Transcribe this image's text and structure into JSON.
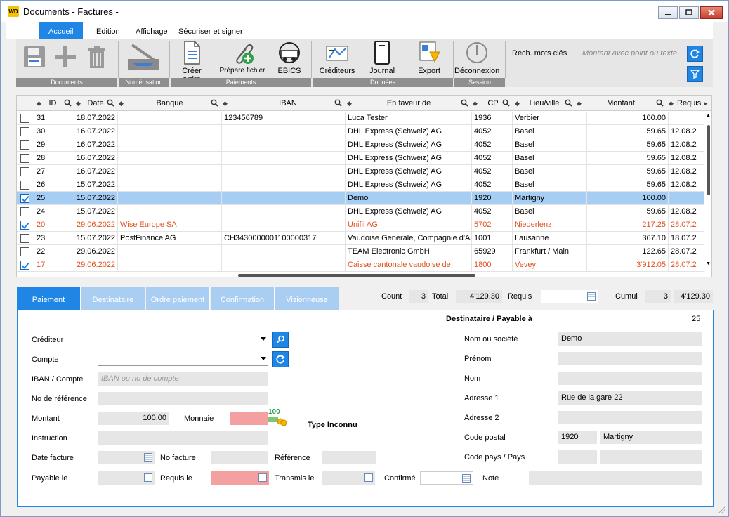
{
  "window": {
    "logo": "WD",
    "title": "Documents - Factures -"
  },
  "menu": {
    "items": [
      "Accueil",
      "Edition",
      "Affichage",
      "Sécuriser et signer"
    ]
  },
  "ribbon": {
    "buttons": [
      "Créer ordre",
      "Prépare fichier",
      "EBICS",
      "Créditeurs",
      "Journal",
      "Export",
      "Déconnexion"
    ],
    "groups": [
      "Documents",
      "Numérisation",
      "Paiements",
      "Données",
      "Session"
    ],
    "search_label": "Rech.  mots clés",
    "search_placeholder": "Montant avec point ou texte"
  },
  "grid": {
    "headers": [
      "ID",
      "Date",
      "Banque",
      "IBAN",
      "En faveur de",
      "CP",
      "Lieu/ville",
      "Montant",
      "Requis"
    ],
    "rows": [
      {
        "checked": false,
        "id": "31",
        "date": "18.07.2022",
        "banque": "",
        "iban": "123456789",
        "faveur": "Luca Tester",
        "cp": "1936",
        "lieu": "Verbier",
        "montant": "100.00",
        "requis": ""
      },
      {
        "checked": false,
        "id": "30",
        "date": "16.07.2022",
        "banque": "",
        "iban": "",
        "faveur": "DHL Express (Schweiz) AG",
        "cp": "4052",
        "lieu": "Basel",
        "montant": "59.65",
        "requis": "12.08.2"
      },
      {
        "checked": false,
        "id": "29",
        "date": "16.07.2022",
        "banque": "",
        "iban": "",
        "faveur": "DHL Express (Schweiz) AG",
        "cp": "4052",
        "lieu": "Basel",
        "montant": "59.65",
        "requis": "12.08.2"
      },
      {
        "checked": false,
        "id": "28",
        "date": "16.07.2022",
        "banque": "",
        "iban": "",
        "faveur": "DHL Express (Schweiz) AG",
        "cp": "4052",
        "lieu": "Basel",
        "montant": "59.65",
        "requis": "12.08.2"
      },
      {
        "checked": false,
        "id": "27",
        "date": "16.07.2022",
        "banque": "",
        "iban": "",
        "faveur": "DHL Express (Schweiz) AG",
        "cp": "4052",
        "lieu": "Basel",
        "montant": "59.65",
        "requis": "12.08.2"
      },
      {
        "checked": false,
        "id": "26",
        "date": "15.07.2022",
        "banque": "",
        "iban": "",
        "faveur": "DHL Express (Schweiz) AG",
        "cp": "4052",
        "lieu": "Basel",
        "montant": "59.65",
        "requis": "12.08.2"
      },
      {
        "checked": true,
        "selected": true,
        "id": "25",
        "date": "15.07.2022",
        "banque": "",
        "iban": "",
        "faveur": "Demo",
        "cp": "1920",
        "lieu": "Martigny",
        "montant": "100.00",
        "requis": ""
      },
      {
        "checked": false,
        "id": "24",
        "date": "15.07.2022",
        "banque": "",
        "iban": "",
        "faveur": "DHL Express (Schweiz) AG",
        "cp": "4052",
        "lieu": "Basel",
        "montant": "59.65",
        "requis": "12.08.2"
      },
      {
        "checked": true,
        "red": true,
        "id": "20",
        "date": "29.06.2022",
        "banque": "Wise Europe SA",
        "iban": "",
        "faveur": "Unifil AG",
        "cp": "5702",
        "lieu": "Niederlenz",
        "montant": "217.25",
        "requis": "28.07.2"
      },
      {
        "checked": false,
        "id": "23",
        "date": "15.07.2022",
        "banque": "PostFinance AG",
        "iban": "CH3430000001100000317",
        "faveur": "Vaudoise Generale, Compagnie d'As",
        "cp": "1001",
        "lieu": " Lausanne",
        "montant": "367.10",
        "requis": "18.07.2"
      },
      {
        "checked": false,
        "id": "22",
        "date": "29.06.2022",
        "banque": "",
        "iban": "",
        "faveur": "TEAM Electronic GmbH",
        "cp": "65929",
        "lieu": "Frankfurt / Main",
        "montant": "122.65",
        "requis": "28.07.2"
      },
      {
        "checked": true,
        "red": true,
        "id": "17",
        "date": "29.06.2022",
        "banque": "",
        "iban": "",
        "faveur": "Caisse cantonale vaudoise de",
        "cp": "1800",
        "lieu": "Vevey",
        "montant": "3'912.05",
        "requis": "28.07.2"
      }
    ]
  },
  "tabs": [
    "Paiement",
    "Destinataire",
    "Ordre paiement",
    "Confirmation",
    "Visionneuse"
  ],
  "summary": {
    "count_label": "Count",
    "count": "3",
    "total_label": "Total",
    "total": "4'129.30",
    "requis_label": "Requis",
    "cumul_label": "Cumul",
    "cumul_count": "3",
    "cumul_total": "4'129.30"
  },
  "form": {
    "crediteur": "Créditeur",
    "compte": "Compte",
    "iban": "IBAN / Compte",
    "iban_placeholder": "IBAN ou no de compte",
    "reference_no": "No de référence",
    "montant": "Montant",
    "montant_value": "100.00",
    "monnaie": "Monnaie",
    "type": "Type Inconnu",
    "instruction": "Instruction",
    "date_facture": "Date facture",
    "no_facture": "No facture",
    "reference": "Référence",
    "payable_le": "Payable le",
    "requis_le": "Requis le",
    "transmis_le": "Transmis le",
    "confirme": "Confirmé",
    "note": "Note",
    "currency_icon_text": "100"
  },
  "destinataire": {
    "header": "Destinataire  / Payable à",
    "id": "25",
    "nom_societe": "Nom ou société",
    "nom_societe_value": "Demo",
    "prenom": "Prénom",
    "nom": "Nom",
    "adresse1": "Adresse 1",
    "adresse1_value": "Rue de la gare 22",
    "adresse2": "Adresse 2",
    "code_postal": "Code postal",
    "code_postal_value": "1920",
    "ville_value": "Martigny",
    "code_pays": "Code pays / Pays"
  },
  "colors": {
    "accent": "#1f86e6",
    "selected_row": "#a6cdf3",
    "alert_text": "#e0501f",
    "required_field": "#f5a0a0"
  }
}
